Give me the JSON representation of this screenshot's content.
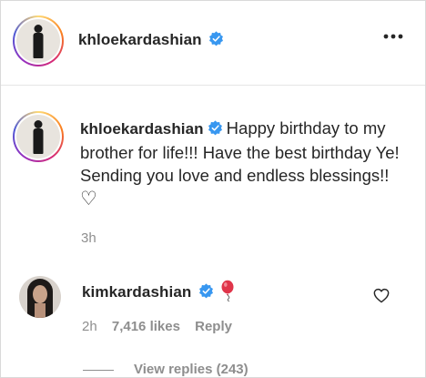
{
  "header": {
    "username": "khloekardashian",
    "verified": true,
    "more_icon": "more-horizontal-icon"
  },
  "caption": {
    "username": "khloekardashian",
    "text": "Happy birthday to my brother for life!!! Have the best birthday Ye! Sending you love and endless blessings!!",
    "emoji": "♡",
    "time": "3h"
  },
  "comments": [
    {
      "username": "kimkardashian",
      "verified": true,
      "emoji_icon": "balloon-icon",
      "time": "2h",
      "likes": "7,416 likes",
      "reply_label": "Reply",
      "like_icon": "heart-outline-icon",
      "view_replies": "View replies (243)"
    }
  ],
  "colors": {
    "verified_blue": "#3897f0",
    "muted": "#8e8e8e",
    "text": "#262626"
  }
}
